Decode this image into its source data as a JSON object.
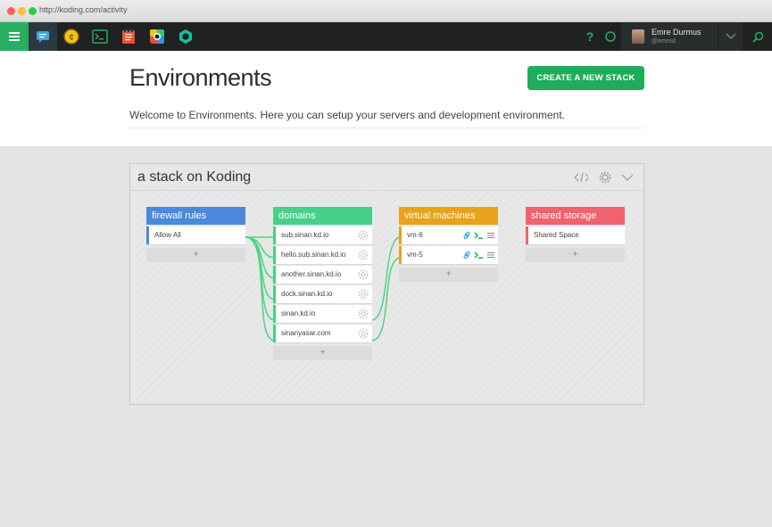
{
  "browser": {
    "url": "http://koding.com/activity"
  },
  "user": {
    "name": "Emre Durmus",
    "handle": "@emred"
  },
  "page": {
    "title": "Environments",
    "create_button": "CREATE A NEW STACK",
    "welcome": "Welcome to Environments. Here you can setup your servers and development environment."
  },
  "stack": {
    "title": "a stack on Koding",
    "columns": {
      "firewall": {
        "title": "firewall rules",
        "items": [
          "Allow All"
        ],
        "color": "#4a89dc"
      },
      "domains": {
        "title": "domains",
        "items": [
          "sub.sinan.kd.io",
          "hello.sub.sinan.kd.io",
          "another.sinan.kd.io",
          "dock.sinan.kd.io",
          "sinan.kd.io",
          "sinanyasar.com"
        ],
        "color": "#48cf8a"
      },
      "vms": {
        "title": "virtual machines",
        "items": [
          "vm-6",
          "vm-5"
        ],
        "color": "#e9a21c"
      },
      "storage": {
        "title": "shared storage",
        "items": [
          "Shared Space"
        ],
        "color": "#f0626e"
      }
    },
    "add_label": "+"
  },
  "colors": {
    "accent": "#1fad5a",
    "nav_bg": "#1f2122"
  }
}
